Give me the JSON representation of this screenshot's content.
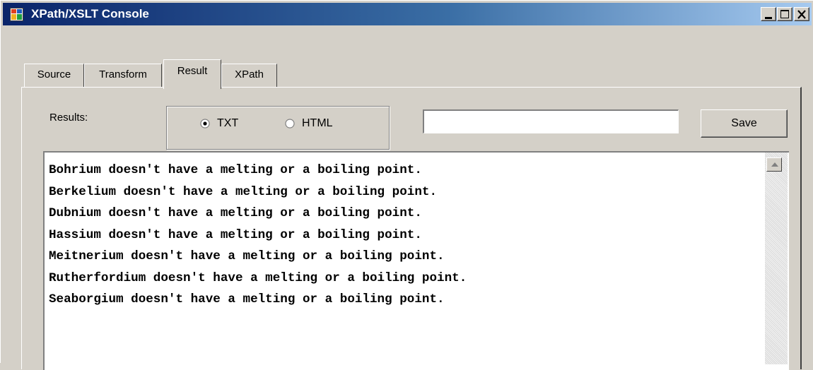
{
  "window": {
    "title": "XPath/XSLT Console",
    "icon": "application-window-icon",
    "controls": [
      "minimize-icon",
      "maximize-icon",
      "close-icon"
    ]
  },
  "tabs": [
    {
      "label": "Source",
      "active": false
    },
    {
      "label": "Transform",
      "active": false
    },
    {
      "label": "Result",
      "active": true
    },
    {
      "label": "XPath",
      "active": false
    }
  ],
  "result_panel": {
    "results_label": "Results:",
    "format_options": [
      {
        "label": "TXT",
        "selected": true
      },
      {
        "label": "HTML",
        "selected": false
      }
    ],
    "output_path_value": "",
    "save_label": "Save",
    "lines": [
      "Bohrium doesn't have a melting or a boiling point.",
      "Berkelium doesn't have a melting or a boiling point.",
      "Dubnium doesn't have a melting or a boiling point.",
      "Hassium doesn't have a melting or a boiling point.",
      "Meitnerium doesn't have a melting or a boiling point.",
      "Rutherfordium doesn't have a melting or a boiling point.",
      "Seaborgium doesn't have a melting or a boiling point."
    ]
  },
  "colors": {
    "face": "#d4d0c8",
    "title_start": "#0a246a",
    "title_end": "#a6caf0"
  }
}
